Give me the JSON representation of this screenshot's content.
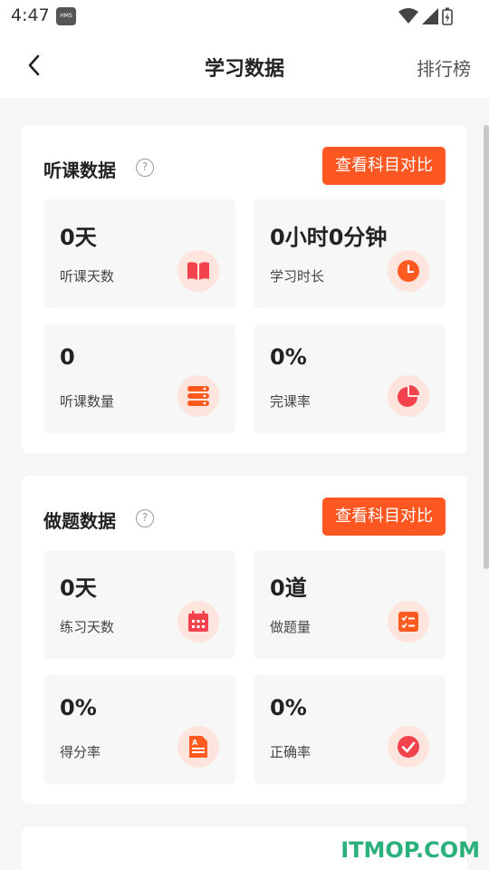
{
  "status": {
    "time": "4:47",
    "badge": "HMS"
  },
  "nav": {
    "title": "学习数据",
    "right_action": "排行榜"
  },
  "listening": {
    "title": "听课数据",
    "help": "?",
    "compare_label": "查看科目对比",
    "stats": [
      {
        "value": "0天",
        "label": "听课天数",
        "icon": "book-icon"
      },
      {
        "value": "0小时0分钟",
        "label": "学习时长",
        "icon": "clock-icon"
      },
      {
        "value": "0",
        "label": "听课数量",
        "icon": "list-stack-icon"
      },
      {
        "value": "0%",
        "label": "完课率",
        "icon": "pie-chart-icon"
      }
    ]
  },
  "practice": {
    "title": "做题数据",
    "help": "?",
    "compare_label": "查看科目对比",
    "stats": [
      {
        "value": "0天",
        "label": "练习天数",
        "icon": "calendar-icon"
      },
      {
        "value": "0道",
        "label": "做题量",
        "icon": "checklist-icon"
      },
      {
        "value": "0%",
        "label": "得分率",
        "icon": "document-score-icon"
      },
      {
        "value": "0%",
        "label": "正确率",
        "icon": "check-circle-icon"
      }
    ]
  },
  "colors": {
    "accent": "#ff5722",
    "icon_bg": "#fde4dc",
    "card_tile": "#f7f7f7"
  },
  "watermark": "ITMOP.COM"
}
